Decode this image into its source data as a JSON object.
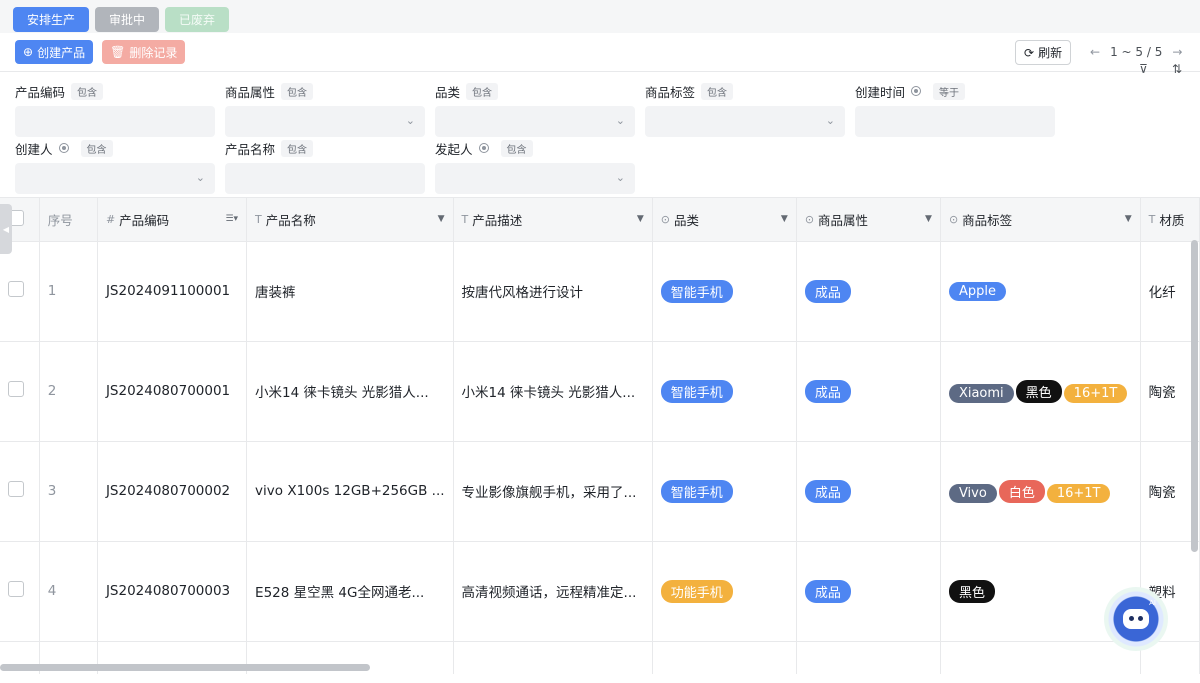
{
  "tabs": [
    {
      "label": "安排生产"
    },
    {
      "label": "审批中"
    },
    {
      "label": "已废弃"
    }
  ],
  "toolbar": {
    "create_label": "创建产品",
    "delete_label": "删除记录",
    "refresh_label": "刷新",
    "page_range": "1 ~ 5 / 5"
  },
  "filters": {
    "product_code": {
      "label": "产品编码",
      "op": "包含"
    },
    "product_attr": {
      "label": "商品属性",
      "op": "包含"
    },
    "category": {
      "label": "品类",
      "op": "包含"
    },
    "product_tag": {
      "label": "商品标签",
      "op": "包含"
    },
    "created_time": {
      "label": "创建时间",
      "op": "等于"
    },
    "creator": {
      "label": "创建人",
      "op": "包含"
    },
    "product_name": {
      "label": "产品名称",
      "op": "包含"
    },
    "initiator": {
      "label": "发起人",
      "op": "包含"
    }
  },
  "table": {
    "headers": {
      "index": "序号",
      "code": "产品编码",
      "name": "产品名称",
      "desc": "产品描述",
      "category": "品类",
      "attr": "商品属性",
      "tags": "商品标签",
      "material": "材质"
    },
    "rows": [
      {
        "index": "1",
        "code": "JS2024091100001",
        "name": "唐装裤",
        "desc": "按唐代风格进行设计",
        "category": "智能手机",
        "attr": "成品",
        "tags": [
          "Apple"
        ],
        "material": "化纤"
      },
      {
        "index": "2",
        "code": "JS2024080700001",
        "name": "小米14 徕卡镜头 光影猎人...",
        "desc": "小米14 徕卡镜头 光影猎人...",
        "category": "智能手机",
        "attr": "成品",
        "tags": [
          "Xiaomi",
          "黑色",
          "16+1T"
        ],
        "material": "陶瓷"
      },
      {
        "index": "3",
        "code": "JS2024080700002",
        "name": "vivo X100s 12GB+256GB ...",
        "desc": "专业影像旗舰手机，采用了...",
        "category": "智能手机",
        "attr": "成品",
        "tags": [
          "Vivo",
          "白色",
          "16+1T"
        ],
        "material": "陶瓷"
      },
      {
        "index": "4",
        "code": "JS2024080700003",
        "name": "E528 星空黑 4G全网通老...",
        "desc": "高清视频通话，远程精准定...",
        "category": "功能手机",
        "attr": "成品",
        "tags": [
          "黑色"
        ],
        "material": "塑料"
      }
    ]
  },
  "assistant": {
    "badge": "AI"
  },
  "colors": {
    "primary": "#4e86f2",
    "danger_light": "#f4aba3",
    "tag_orange": "#f3b13e",
    "tag_slate": "#5d6a84",
    "tag_red": "#e8675a"
  }
}
